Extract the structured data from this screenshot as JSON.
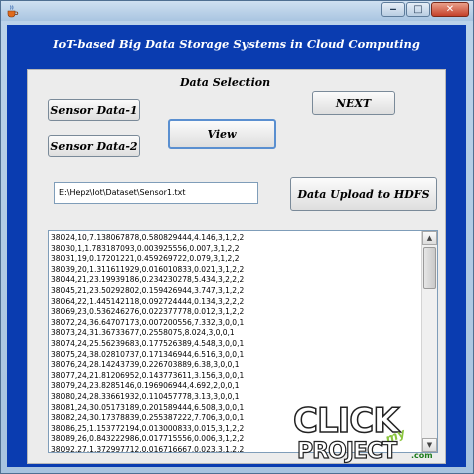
{
  "app": {
    "title": "IoT-based Big Data Storage Systems in Cloud Computing"
  },
  "window_controls": {
    "minimize": "‒",
    "maximize": "□",
    "close": "✕"
  },
  "panel": {
    "section_label": "Data Selection",
    "buttons": {
      "sensor1": "Sensor Data-1",
      "sensor2": "Sensor Data-2",
      "view": "View",
      "next": "NEXT",
      "upload": "Data Upload to HDFS"
    },
    "path_value": "E:\\Hepz\\Iot\\Dataset\\Sensor1.txt"
  },
  "data_lines": [
    "38024,10,7.138067878,0.580829444,4.146,3,1,2,2",
    "38030,1,1.783187093,0.003925556,0.007,3,1,2,2",
    "38031,19,0.17201221,0.459269722,0.079,3,1,2,2",
    "38039,20,1.311611929,0.016010833,0.021,3,1,2,2",
    "38044,21,23.19939186,0.234230278,5.434,3,2,2,2",
    "38045,21,23.50292802,0.159426944,3.747,3,1,2,2",
    "38064,22,1.445142118,0.092724444,0.134,3,2,2,2",
    "38069,23,0.536246276,0.022377778,0.012,3,1,2,2",
    "38072,24,36.64707173,0.007200556,7.332,3,0,0,1",
    "38073,24,31.36733677,0.2558075,8.024,3,0,0,1",
    "38074,24,25.56239683,0.177526389,4.548,3,0,0,1",
    "38075,24,38.02810737,0.171346944,6.516,3,0,0,1",
    "38076,24,28.14243739,0.226703889,6.38,3,0,0,1",
    "38077,24,21.81206952,0.143773611,3.156,3,0,0,1",
    "38079,24,23.8285146,0.196906944,4.692,2,0,0,1",
    "38080,24,28.33661932,0.110457778,3.13,3,0,0,1",
    "38081,24,30.05173189,0.201589444,6.508,3,0,0,1",
    "38082,24,30.17378839,0.255387222,7.706,3,0,0,1",
    "38086,25,1.153772194,0.013000833,0.015,3,1,2,2",
    "38089,26,0.843222986,0.017715556,0.006,3,1,2,2",
    "38092,27,1.372997712,0.016716667,0.023,3,1,2,2"
  ],
  "watermark": {
    "click": "CLICK",
    "my": "my",
    "project": "PROJECT",
    "com": ".com"
  }
}
